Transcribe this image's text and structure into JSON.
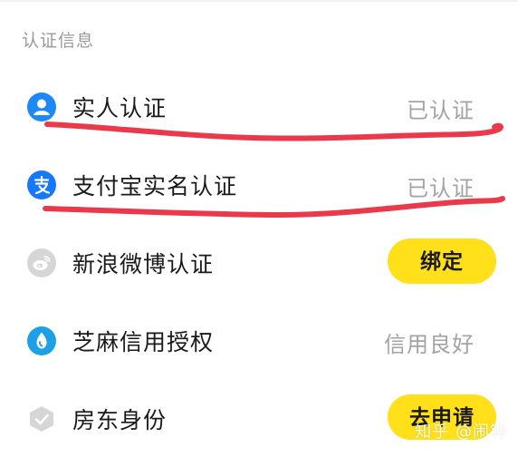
{
  "section": {
    "title": "认证信息"
  },
  "items": [
    {
      "label": "实人认证",
      "status": "已认证",
      "icon": "person-icon",
      "icon_color": "#1e88f5"
    },
    {
      "label": "支付宝实名认证",
      "status": "已认证",
      "icon": "alipay-icon",
      "icon_color": "#1677ff"
    },
    {
      "label": "新浪微博认证",
      "action": "绑定",
      "icon": "weibo-icon",
      "icon_color": "#d6d6d6"
    },
    {
      "label": "芝麻信用授权",
      "status": "信用良好",
      "icon": "sesame-credit-icon",
      "icon_color": "#1ea0e6"
    },
    {
      "label": "房东身份",
      "action": "去申请",
      "icon": "landlord-check-icon",
      "icon_color": "#d6d6d6"
    }
  ],
  "watermark": "知乎 @闹钟",
  "colors": {
    "accent_button": "#ffe01b",
    "annotation_red": "#e8283c",
    "status_gray": "#a3a3a3"
  }
}
